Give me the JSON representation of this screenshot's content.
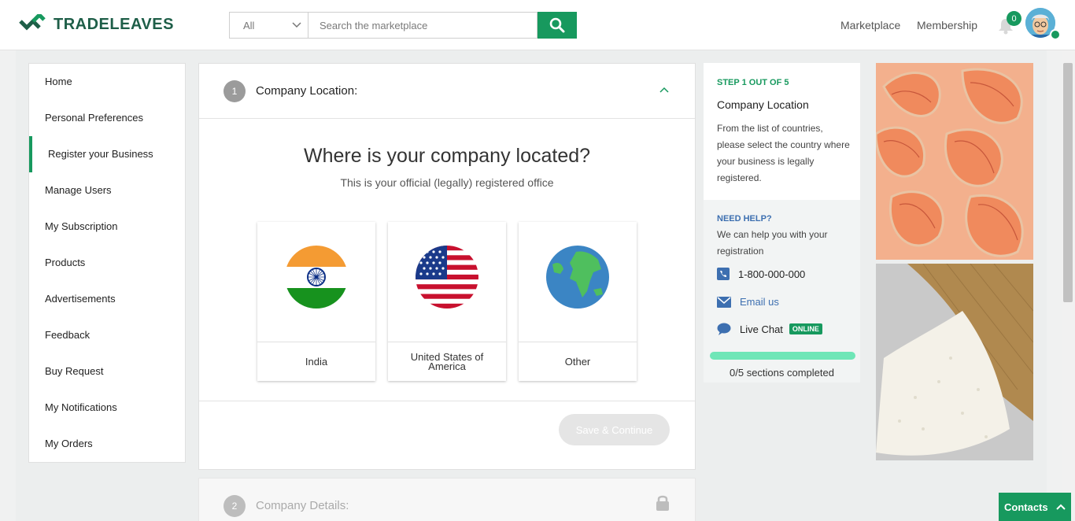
{
  "header": {
    "brand": "TRADELEAVES",
    "search": {
      "category": "All",
      "placeholder": "Search the marketplace"
    },
    "nav": [
      "Marketplace",
      "Membership"
    ],
    "notification_count": "0"
  },
  "sidebar": {
    "items": [
      {
        "label": "Home"
      },
      {
        "label": "Personal Preferences"
      },
      {
        "label": "Register your Business"
      },
      {
        "label": "Manage Users"
      },
      {
        "label": "My Subscription"
      },
      {
        "label": "Products"
      },
      {
        "label": "Advertisements"
      },
      {
        "label": "Feedback"
      },
      {
        "label": "Buy Request"
      },
      {
        "label": "My Notifications"
      },
      {
        "label": "My Orders"
      }
    ],
    "active": "Register your Business"
  },
  "main": {
    "step1": {
      "number": "1",
      "title": "Company Location:"
    },
    "question": "Where is your company located?",
    "subtitle": "This is your official (legally) registered office",
    "countries": [
      {
        "label": "India",
        "flag": "india-flag-icon"
      },
      {
        "label": "United States of America",
        "flag": "usa-flag-icon"
      },
      {
        "label": "Other",
        "flag": "globe-icon"
      }
    ],
    "save_button": "Save & Continue",
    "step2": {
      "number": "2",
      "title": "Company Details:"
    }
  },
  "info_panel": {
    "step_label": "STEP 1 OUT OF 5",
    "title": "Company Location",
    "description": "From the list of countries, please select the country where your business is legally registered.",
    "need_help_label": "NEED HELP?",
    "help_text": "We can help you with your registration",
    "phone": "1-800-000-000",
    "email_label": "Email us",
    "live_chat_label": "Live Chat",
    "online_badge": "ONLINE",
    "progress_text": "0/5 sections completed",
    "progress": 0
  },
  "contacts_button": "Contacts",
  "colors": {
    "brand_green": "#17995e",
    "link_blue": "#3d6fb0"
  }
}
